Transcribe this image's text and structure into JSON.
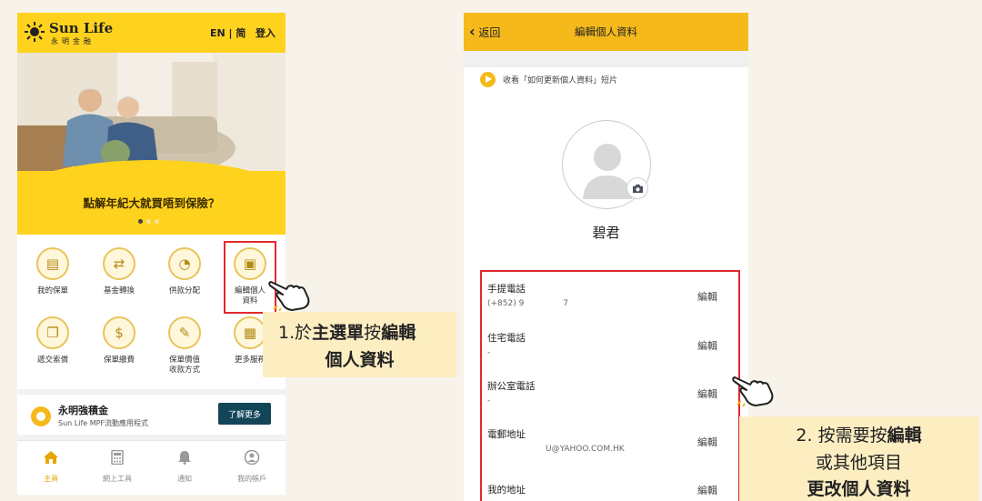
{
  "home": {
    "brand": {
      "name_en": "Sun Life",
      "name_zh": "永明金融"
    },
    "lang_toggle": "EN | 简",
    "login": "登入",
    "banner_text": "點解年紀大就買唔到保險？",
    "menu": [
      {
        "label": "我的保單",
        "icon": "policy-icon"
      },
      {
        "label": "基金轉換",
        "icon": "fund-switch-icon"
      },
      {
        "label": "供款分配",
        "icon": "pie-chart-icon"
      },
      {
        "label": "編輯個人\n資料",
        "icon": "profile-card-icon"
      },
      {
        "label": "遞交索償",
        "icon": "claim-document-icon"
      },
      {
        "label": "保單繳費",
        "icon": "payment-icon"
      },
      {
        "label": "保單價值\n收款方式",
        "icon": "payout-icon"
      },
      {
        "label": "更多服務",
        "icon": "grid-icon"
      }
    ],
    "mpf": {
      "title": "永明強積金",
      "subtitle": "Sun Life MPF流動應用程式",
      "button": "了解更多"
    },
    "tabs": [
      "主頁",
      "網上工具",
      "通知",
      "我的帳戶"
    ]
  },
  "step1": {
    "number": "1.",
    "prefix": "於",
    "menu": "主選單",
    "press": "按",
    "edit": "編輯",
    "line2": "個人資料"
  },
  "profile": {
    "back": "返回",
    "title": "編輯個人資料",
    "video_text": "收看「如何更新個人資料」短片",
    "name": "碧君",
    "edit_label": "編輯",
    "fields": [
      {
        "label": "手提電話",
        "value": "(+852) 9               7"
      },
      {
        "label": "住宅電話",
        "value": "-"
      },
      {
        "label": "辦公室電話",
        "value": "-"
      },
      {
        "label": "電郵地址",
        "value": "U@YAHOO.COM.HK"
      },
      {
        "label": "我的地址",
        "value": ""
      }
    ]
  },
  "step2": {
    "line1_prefix": "2. 按需要按",
    "line1_bold": "編輯",
    "line2": "或其他項目",
    "line3": "更改個人資料"
  },
  "colors": {
    "brand_yellow": "#ffd21e",
    "header_orange": "#f5b91c",
    "highlight_red": "#e0292b",
    "button_navy": "#124558",
    "callout_bg": "#fdeec2"
  }
}
